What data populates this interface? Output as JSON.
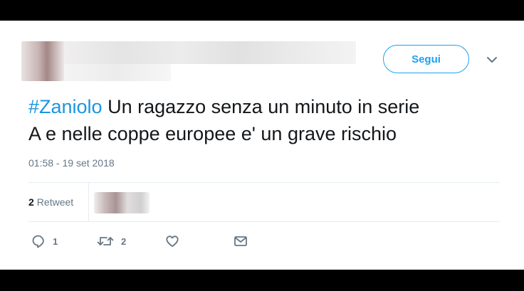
{
  "tweet": {
    "follow_label": "Segui",
    "hashtag": "#Zaniolo",
    "text_line1_rest": " Un ragazzo senza un minuto in serie",
    "text_line2": "A e nelle coppe europee e' un grave rischio",
    "timestamp": "01:58 - 19 set 2018",
    "retweet_count": "2",
    "retweet_label": "Retweet",
    "reply_count": "1",
    "retweet_action_count": "2"
  },
  "colors": {
    "accent": "#1da1f2",
    "hashtag": "#1b95e0",
    "muted": "#657786",
    "text": "#14171a"
  },
  "icons": [
    "chevron-down-icon",
    "reply-icon",
    "retweet-icon",
    "heart-icon",
    "envelope-icon"
  ]
}
